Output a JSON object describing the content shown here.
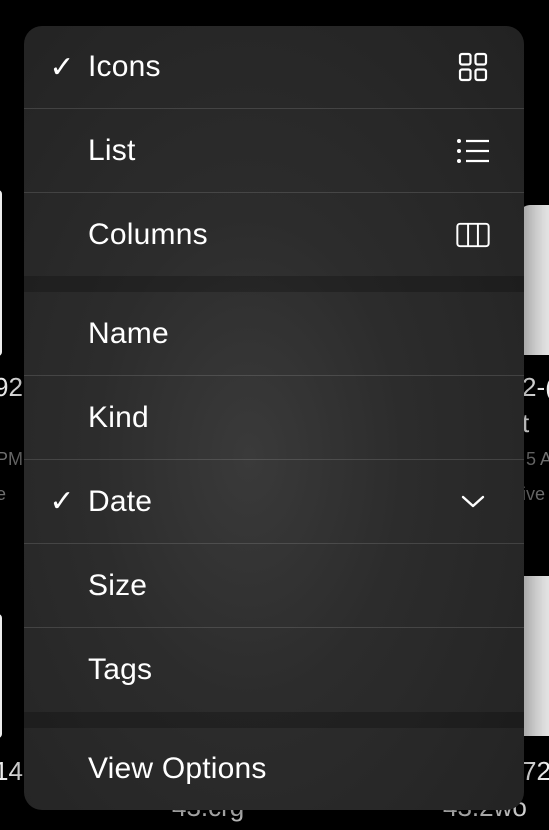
{
  "background": {
    "left_filename_fragment_1": "92",
    "left_time_fragment_1": "PM",
    "left_kind_fragment_1": "e",
    "left_filename_fragment_2": "14",
    "right_filename_fragment_1a": "2-(",
    "right_filename_fragment_1b": "t",
    "right_time_fragment_1": "5 A",
    "right_kind_fragment_1": "ive",
    "right_filename_fragment_2": "72",
    "bottom_filename_fragment_a": "43.crg",
    "bottom_filename_fragment_b": "43.2wo"
  },
  "menu": {
    "view_group": [
      {
        "label": "Icons",
        "checked": true,
        "icon": "grid-icon"
      },
      {
        "label": "List",
        "checked": false,
        "icon": "list-icon"
      },
      {
        "label": "Columns",
        "checked": false,
        "icon": "columns-icon"
      }
    ],
    "sort_group": [
      {
        "label": "Name",
        "checked": false
      },
      {
        "label": "Kind",
        "checked": false
      },
      {
        "label": "Date",
        "checked": true,
        "icon": "chevron-down-icon"
      },
      {
        "label": "Size",
        "checked": false
      },
      {
        "label": "Tags",
        "checked": false
      }
    ],
    "options_group": [
      {
        "label": "View Options"
      }
    ],
    "check_glyph": "✓"
  }
}
